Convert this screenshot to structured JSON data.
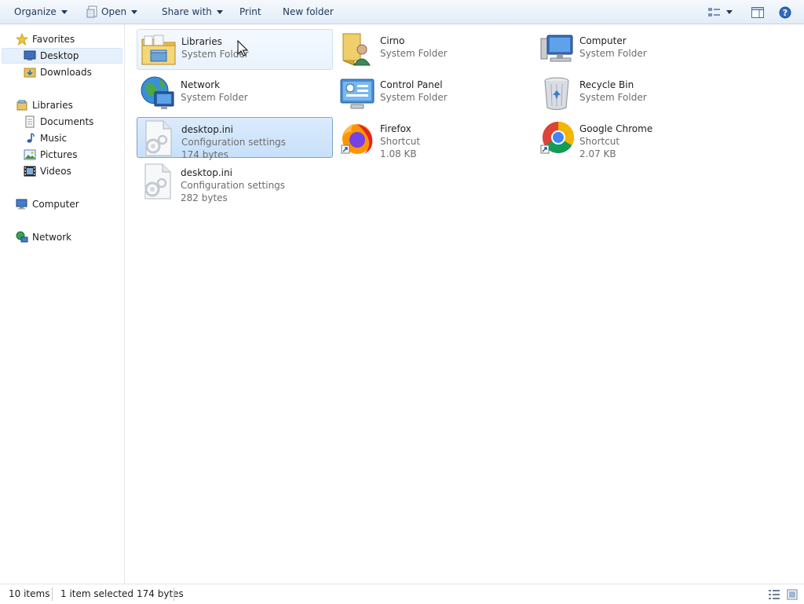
{
  "toolbar": {
    "organize": "Organize",
    "open": "Open",
    "share_with": "Share with",
    "print": "Print",
    "new_folder": "New folder"
  },
  "nav": {
    "favorites": "Favorites",
    "desktop": "Desktop",
    "downloads": "Downloads",
    "libraries": "Libraries",
    "documents": "Documents",
    "music": "Music",
    "pictures": "Pictures",
    "videos": "Videos",
    "computer": "Computer",
    "network": "Network"
  },
  "items": [
    {
      "name": "Libraries",
      "type": "System Folder",
      "icon": "libraries-folder-icon"
    },
    {
      "name": "Cirno",
      "type": "System Folder",
      "icon": "user-folder-icon"
    },
    {
      "name": "Computer",
      "type": "System Folder",
      "icon": "computer-icon"
    },
    {
      "name": "Network",
      "type": "System Folder",
      "icon": "network-globe-icon"
    },
    {
      "name": "Control Panel",
      "type": "System Folder",
      "icon": "control-panel-icon"
    },
    {
      "name": "Recycle Bin",
      "type": "System Folder",
      "icon": "recycle-bin-icon"
    },
    {
      "name": "desktop.ini",
      "type": "Configuration settings",
      "size": "174 bytes",
      "icon": "settings-file-icon"
    },
    {
      "name": "Firefox",
      "type": "Shortcut",
      "size": "1.08 KB",
      "icon": "firefox-icon"
    },
    {
      "name": "Google Chrome",
      "type": "Shortcut",
      "size": "2.07 KB",
      "icon": "chrome-icon"
    },
    {
      "name": "desktop.ini",
      "type": "Configuration settings",
      "size": "282 bytes",
      "icon": "settings-file-icon"
    }
  ],
  "status": {
    "count": "10 items",
    "selection": "1 item selected",
    "selection_size": "174 bytes"
  }
}
